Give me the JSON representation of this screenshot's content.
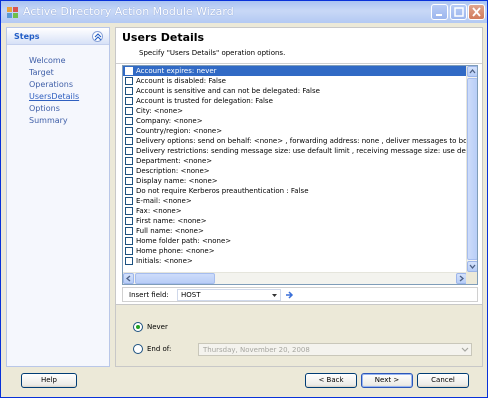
{
  "window": {
    "title": "Active Directory Action Module Wizard"
  },
  "sidebar": {
    "title": "Steps",
    "items": [
      {
        "label": "Welcome"
      },
      {
        "label": "Target"
      },
      {
        "label": "Operations"
      },
      {
        "label": "UsersDetails",
        "current": true
      },
      {
        "label": "Options"
      },
      {
        "label": "Summary"
      }
    ]
  },
  "main": {
    "title": "Users Details",
    "subtitle": "Specify \"Users Details\" operation options.",
    "rows": [
      {
        "label": "Account expires: never",
        "selected": true
      },
      {
        "label": "Account is disabled: False"
      },
      {
        "label": "Account is sensitive and can not be delegated: False"
      },
      {
        "label": "Account is trusted for delegation: False"
      },
      {
        "label": "City: <none>"
      },
      {
        "label": "Company: <none>"
      },
      {
        "label": "Country/region: <none>"
      },
      {
        "label": "Delivery options: send on behalf: <none> , forwarding address: none , deliver messages to both f"
      },
      {
        "label": "Delivery restrictions: sending message size: use default limit , receiving message size: use default l"
      },
      {
        "label": "Department: <none>"
      },
      {
        "label": "Description: <none>"
      },
      {
        "label": "Display name: <none>"
      },
      {
        "label": "Do not require Kerberos preauthentication : False"
      },
      {
        "label": "E-mail: <none>"
      },
      {
        "label": "Fax: <none>"
      },
      {
        "label": "First name: <none>"
      },
      {
        "label": "Full name: <none>"
      },
      {
        "label": "Home folder path: <none>"
      },
      {
        "label": "Home phone: <none>"
      },
      {
        "label": "Initials: <none>"
      }
    ],
    "insert_field": {
      "label": "Insert field:",
      "value": "HOST"
    },
    "options": {
      "never_label": "Never",
      "end_of_label": "End of:",
      "date_value": "Thursday, November 20, 2008",
      "selected": "Never"
    }
  },
  "buttons": {
    "help": "Help",
    "back": "< Back",
    "next": "Next >",
    "cancel": "Cancel"
  }
}
